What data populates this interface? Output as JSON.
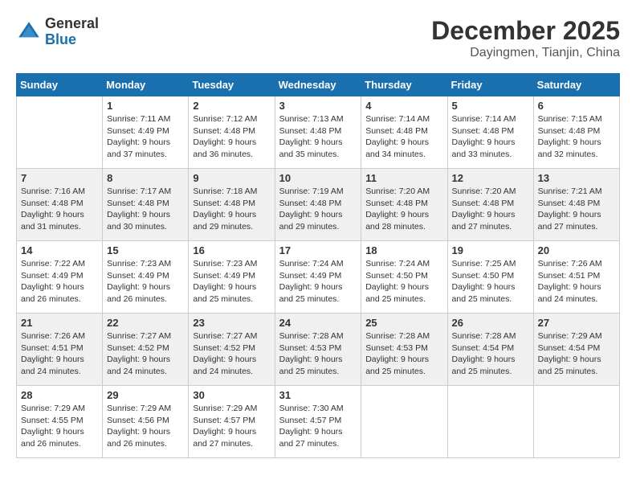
{
  "header": {
    "logo": {
      "general": "General",
      "blue": "Blue"
    },
    "title": "December 2025",
    "location": "Dayingmen, Tianjin, China"
  },
  "columns": [
    "Sunday",
    "Monday",
    "Tuesday",
    "Wednesday",
    "Thursday",
    "Friday",
    "Saturday"
  ],
  "weeks": [
    [
      {
        "day": "",
        "info": ""
      },
      {
        "day": "1",
        "info": "Sunrise: 7:11 AM\nSunset: 4:49 PM\nDaylight: 9 hours\nand 37 minutes."
      },
      {
        "day": "2",
        "info": "Sunrise: 7:12 AM\nSunset: 4:48 PM\nDaylight: 9 hours\nand 36 minutes."
      },
      {
        "day": "3",
        "info": "Sunrise: 7:13 AM\nSunset: 4:48 PM\nDaylight: 9 hours\nand 35 minutes."
      },
      {
        "day": "4",
        "info": "Sunrise: 7:14 AM\nSunset: 4:48 PM\nDaylight: 9 hours\nand 34 minutes."
      },
      {
        "day": "5",
        "info": "Sunrise: 7:14 AM\nSunset: 4:48 PM\nDaylight: 9 hours\nand 33 minutes."
      },
      {
        "day": "6",
        "info": "Sunrise: 7:15 AM\nSunset: 4:48 PM\nDaylight: 9 hours\nand 32 minutes."
      }
    ],
    [
      {
        "day": "7",
        "info": "Sunrise: 7:16 AM\nSunset: 4:48 PM\nDaylight: 9 hours\nand 31 minutes."
      },
      {
        "day": "8",
        "info": "Sunrise: 7:17 AM\nSunset: 4:48 PM\nDaylight: 9 hours\nand 30 minutes."
      },
      {
        "day": "9",
        "info": "Sunrise: 7:18 AM\nSunset: 4:48 PM\nDaylight: 9 hours\nand 29 minutes."
      },
      {
        "day": "10",
        "info": "Sunrise: 7:19 AM\nSunset: 4:48 PM\nDaylight: 9 hours\nand 29 minutes."
      },
      {
        "day": "11",
        "info": "Sunrise: 7:20 AM\nSunset: 4:48 PM\nDaylight: 9 hours\nand 28 minutes."
      },
      {
        "day": "12",
        "info": "Sunrise: 7:20 AM\nSunset: 4:48 PM\nDaylight: 9 hours\nand 27 minutes."
      },
      {
        "day": "13",
        "info": "Sunrise: 7:21 AM\nSunset: 4:48 PM\nDaylight: 9 hours\nand 27 minutes."
      }
    ],
    [
      {
        "day": "14",
        "info": "Sunrise: 7:22 AM\nSunset: 4:49 PM\nDaylight: 9 hours\nand 26 minutes."
      },
      {
        "day": "15",
        "info": "Sunrise: 7:23 AM\nSunset: 4:49 PM\nDaylight: 9 hours\nand 26 minutes."
      },
      {
        "day": "16",
        "info": "Sunrise: 7:23 AM\nSunset: 4:49 PM\nDaylight: 9 hours\nand 25 minutes."
      },
      {
        "day": "17",
        "info": "Sunrise: 7:24 AM\nSunset: 4:49 PM\nDaylight: 9 hours\nand 25 minutes."
      },
      {
        "day": "18",
        "info": "Sunrise: 7:24 AM\nSunset: 4:50 PM\nDaylight: 9 hours\nand 25 minutes."
      },
      {
        "day": "19",
        "info": "Sunrise: 7:25 AM\nSunset: 4:50 PM\nDaylight: 9 hours\nand 25 minutes."
      },
      {
        "day": "20",
        "info": "Sunrise: 7:26 AM\nSunset: 4:51 PM\nDaylight: 9 hours\nand 24 minutes."
      }
    ],
    [
      {
        "day": "21",
        "info": "Sunrise: 7:26 AM\nSunset: 4:51 PM\nDaylight: 9 hours\nand 24 minutes."
      },
      {
        "day": "22",
        "info": "Sunrise: 7:27 AM\nSunset: 4:52 PM\nDaylight: 9 hours\nand 24 minutes."
      },
      {
        "day": "23",
        "info": "Sunrise: 7:27 AM\nSunset: 4:52 PM\nDaylight: 9 hours\nand 24 minutes."
      },
      {
        "day": "24",
        "info": "Sunrise: 7:28 AM\nSunset: 4:53 PM\nDaylight: 9 hours\nand 25 minutes."
      },
      {
        "day": "25",
        "info": "Sunrise: 7:28 AM\nSunset: 4:53 PM\nDaylight: 9 hours\nand 25 minutes."
      },
      {
        "day": "26",
        "info": "Sunrise: 7:28 AM\nSunset: 4:54 PM\nDaylight: 9 hours\nand 25 minutes."
      },
      {
        "day": "27",
        "info": "Sunrise: 7:29 AM\nSunset: 4:54 PM\nDaylight: 9 hours\nand 25 minutes."
      }
    ],
    [
      {
        "day": "28",
        "info": "Sunrise: 7:29 AM\nSunset: 4:55 PM\nDaylight: 9 hours\nand 26 minutes."
      },
      {
        "day": "29",
        "info": "Sunrise: 7:29 AM\nSunset: 4:56 PM\nDaylight: 9 hours\nand 26 minutes."
      },
      {
        "day": "30",
        "info": "Sunrise: 7:29 AM\nSunset: 4:57 PM\nDaylight: 9 hours\nand 27 minutes."
      },
      {
        "day": "31",
        "info": "Sunrise: 7:30 AM\nSunset: 4:57 PM\nDaylight: 9 hours\nand 27 minutes."
      },
      {
        "day": "",
        "info": ""
      },
      {
        "day": "",
        "info": ""
      },
      {
        "day": "",
        "info": ""
      }
    ]
  ]
}
